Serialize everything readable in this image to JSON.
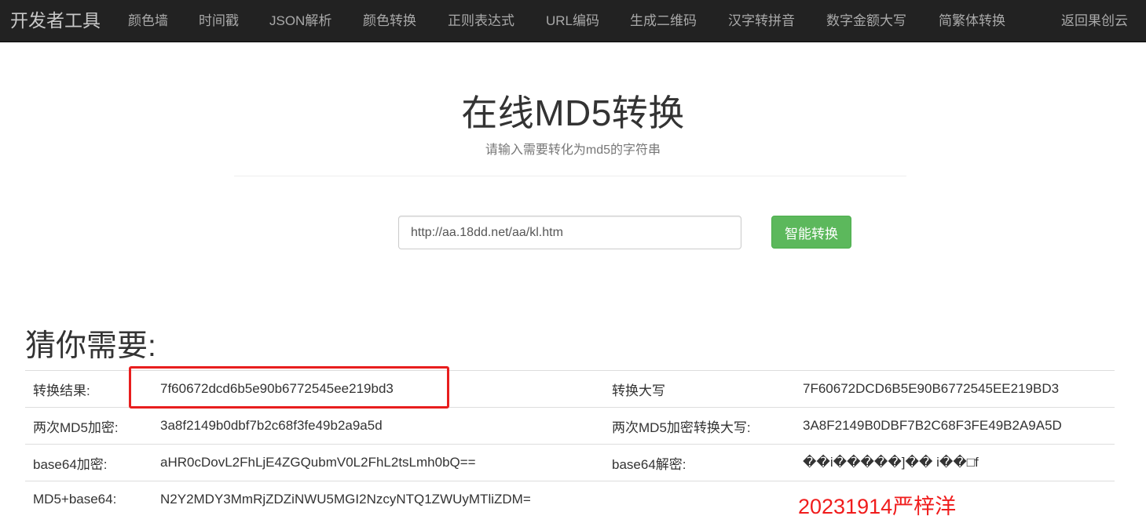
{
  "navbar": {
    "brand": "开发者工具",
    "items": [
      "颜色墙",
      "时间戳",
      "JSON解析",
      "颜色转换",
      "正则表达式",
      "URL编码",
      "生成二维码",
      "汉字转拼音",
      "数字金额大写",
      "简繁体转换"
    ],
    "return_link": "返回果创云"
  },
  "header": {
    "title": "在线MD5转换",
    "subtitle": "请输入需要转化为md5的字符串"
  },
  "form": {
    "input_value": "http://aa.18dd.net/aa/kl.htm",
    "button_label": "智能转换"
  },
  "results": {
    "heading": "猜你需要:",
    "rows": [
      {
        "label1": "转换结果:",
        "value1": "7f60672dcd6b5e90b6772545ee219bd3",
        "label2": "转换大写",
        "value2": "7F60672DCD6B5E90B6772545EE219BD3"
      },
      {
        "label1": "两次MD5加密:",
        "value1": "3a8f2149b0dbf7b2c68f3fe49b2a9a5d",
        "label2": "两次MD5加密转换大写:",
        "value2": "3A8F2149B0DBF7B2C68F3FE49B2A9A5D"
      },
      {
        "label1": "base64加密:",
        "value1": "aHR0cDovL2FhLjE4ZGQubmV0L2FhL2tsLmh0bQ==",
        "label2": "base64解密:",
        "value2": "��i�����]�� i��□f"
      },
      {
        "label1": "MD5+base64:",
        "value1": "N2Y2MDY3MmRjZDZiNWU5MGI2NzcyNTQ1ZWUyMTliZDM=",
        "label2": "",
        "value2": ""
      }
    ]
  },
  "annotation": {
    "text": "20231914严梓洋",
    "color": "#f01c1c"
  },
  "colors": {
    "navbar_bg": "#222222",
    "button_bg": "#5cb85c",
    "highlight": "#e81e1e"
  }
}
